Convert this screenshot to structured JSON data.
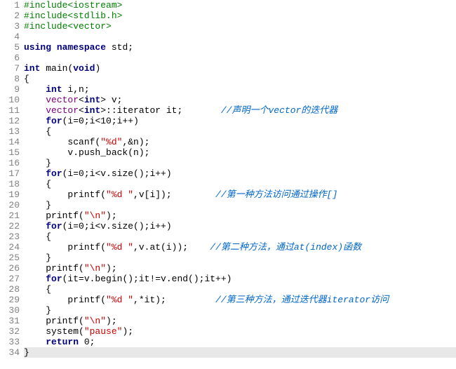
{
  "lines": [
    {
      "n": 1,
      "tokens": [
        {
          "cls": "preproc",
          "t": "#include<iostream>"
        }
      ]
    },
    {
      "n": 2,
      "tokens": [
        {
          "cls": "preproc",
          "t": "#include<stdlib.h>"
        }
      ]
    },
    {
      "n": 3,
      "tokens": [
        {
          "cls": "preproc",
          "t": "#include<vector>"
        }
      ]
    },
    {
      "n": 4,
      "tokens": []
    },
    {
      "n": 5,
      "tokens": [
        {
          "cls": "kw",
          "t": "using"
        },
        {
          "cls": "pn",
          "t": " "
        },
        {
          "cls": "kw",
          "t": "namespace"
        },
        {
          "cls": "pn",
          "t": " std;"
        }
      ]
    },
    {
      "n": 6,
      "tokens": []
    },
    {
      "n": 7,
      "tokens": [
        {
          "cls": "kw",
          "t": "int"
        },
        {
          "cls": "pn",
          "t": " "
        },
        {
          "cls": "id",
          "t": "main"
        },
        {
          "cls": "pn",
          "t": "("
        },
        {
          "cls": "kw",
          "t": "void"
        },
        {
          "cls": "pn",
          "t": ")"
        }
      ]
    },
    {
      "n": 8,
      "tokens": [
        {
          "cls": "pn",
          "t": "{"
        }
      ]
    },
    {
      "n": 9,
      "tokens": [
        {
          "cls": "pn",
          "t": "    "
        },
        {
          "cls": "kw",
          "t": "int"
        },
        {
          "cls": "pn",
          "t": " i,n;"
        }
      ]
    },
    {
      "n": 10,
      "tokens": [
        {
          "cls": "pn",
          "t": "    "
        },
        {
          "cls": "type",
          "t": "vector"
        },
        {
          "cls": "pn",
          "t": "<"
        },
        {
          "cls": "kw",
          "t": "int"
        },
        {
          "cls": "pn",
          "t": "> v;"
        }
      ]
    },
    {
      "n": 11,
      "tokens": [
        {
          "cls": "pn",
          "t": "    "
        },
        {
          "cls": "type",
          "t": "vector"
        },
        {
          "cls": "pn",
          "t": "<"
        },
        {
          "cls": "kw",
          "t": "int"
        },
        {
          "cls": "pn",
          "t": ">::iterator it;       "
        },
        {
          "cls": "cmt",
          "t": "//声明一个vector的迭代器"
        }
      ]
    },
    {
      "n": 12,
      "tokens": [
        {
          "cls": "pn",
          "t": "    "
        },
        {
          "cls": "kw",
          "t": "for"
        },
        {
          "cls": "pn",
          "t": "(i="
        },
        {
          "cls": "num",
          "t": "0"
        },
        {
          "cls": "pn",
          "t": ";i<"
        },
        {
          "cls": "num",
          "t": "10"
        },
        {
          "cls": "pn",
          "t": ";i++)"
        }
      ]
    },
    {
      "n": 13,
      "tokens": [
        {
          "cls": "pn",
          "t": "    {"
        }
      ]
    },
    {
      "n": 14,
      "tokens": [
        {
          "cls": "pn",
          "t": "        scanf("
        },
        {
          "cls": "str",
          "t": "\"%d\""
        },
        {
          "cls": "pn",
          "t": ",&n);"
        }
      ]
    },
    {
      "n": 15,
      "tokens": [
        {
          "cls": "pn",
          "t": "        v.push_back(n);"
        }
      ]
    },
    {
      "n": 16,
      "tokens": [
        {
          "cls": "pn",
          "t": "    }"
        }
      ]
    },
    {
      "n": 17,
      "tokens": [
        {
          "cls": "pn",
          "t": "    "
        },
        {
          "cls": "kw",
          "t": "for"
        },
        {
          "cls": "pn",
          "t": "(i="
        },
        {
          "cls": "num",
          "t": "0"
        },
        {
          "cls": "pn",
          "t": ";i<v.size();i++)"
        }
      ]
    },
    {
      "n": 18,
      "tokens": [
        {
          "cls": "pn",
          "t": "    {"
        }
      ]
    },
    {
      "n": 19,
      "tokens": [
        {
          "cls": "pn",
          "t": "        printf("
        },
        {
          "cls": "str",
          "t": "\"%d \""
        },
        {
          "cls": "pn",
          "t": ",v[i]);        "
        },
        {
          "cls": "cmt",
          "t": "//第一种方法访问通过操作[]"
        }
      ]
    },
    {
      "n": 20,
      "tokens": [
        {
          "cls": "pn",
          "t": "    }"
        }
      ]
    },
    {
      "n": 21,
      "tokens": [
        {
          "cls": "pn",
          "t": "    printf("
        },
        {
          "cls": "str",
          "t": "\"\\n\""
        },
        {
          "cls": "pn",
          "t": ");"
        }
      ]
    },
    {
      "n": 22,
      "tokens": [
        {
          "cls": "pn",
          "t": "    "
        },
        {
          "cls": "kw",
          "t": "for"
        },
        {
          "cls": "pn",
          "t": "(i="
        },
        {
          "cls": "num",
          "t": "0"
        },
        {
          "cls": "pn",
          "t": ";i<v.size();i++)"
        }
      ]
    },
    {
      "n": 23,
      "tokens": [
        {
          "cls": "pn",
          "t": "    {"
        }
      ]
    },
    {
      "n": 24,
      "tokens": [
        {
          "cls": "pn",
          "t": "        printf("
        },
        {
          "cls": "str",
          "t": "\"%d \""
        },
        {
          "cls": "pn",
          "t": ",v.at(i));    "
        },
        {
          "cls": "cmt",
          "t": "//第二种方法，通过at(index)函数"
        }
      ]
    },
    {
      "n": 25,
      "tokens": [
        {
          "cls": "pn",
          "t": "    }"
        }
      ]
    },
    {
      "n": 26,
      "tokens": [
        {
          "cls": "pn",
          "t": "    printf("
        },
        {
          "cls": "str",
          "t": "\"\\n\""
        },
        {
          "cls": "pn",
          "t": ");"
        }
      ]
    },
    {
      "n": 27,
      "tokens": [
        {
          "cls": "pn",
          "t": "    "
        },
        {
          "cls": "kw",
          "t": "for"
        },
        {
          "cls": "pn",
          "t": "(it=v.begin();it!=v.end();it++)"
        }
      ]
    },
    {
      "n": 28,
      "tokens": [
        {
          "cls": "pn",
          "t": "    {"
        }
      ]
    },
    {
      "n": 29,
      "tokens": [
        {
          "cls": "pn",
          "t": "        printf("
        },
        {
          "cls": "str",
          "t": "\"%d \""
        },
        {
          "cls": "pn",
          "t": ",*it);         "
        },
        {
          "cls": "cmt",
          "t": "//第三种方法，通过迭代器iterator访问"
        }
      ]
    },
    {
      "n": 30,
      "tokens": [
        {
          "cls": "pn",
          "t": "    }"
        }
      ]
    },
    {
      "n": 31,
      "tokens": [
        {
          "cls": "pn",
          "t": "    printf("
        },
        {
          "cls": "str",
          "t": "\"\\n\""
        },
        {
          "cls": "pn",
          "t": ");"
        }
      ]
    },
    {
      "n": 32,
      "tokens": [
        {
          "cls": "pn",
          "t": "    system("
        },
        {
          "cls": "str",
          "t": "\"pause\""
        },
        {
          "cls": "pn",
          "t": ");"
        }
      ]
    },
    {
      "n": 33,
      "tokens": [
        {
          "cls": "pn",
          "t": "    "
        },
        {
          "cls": "kw",
          "t": "return"
        },
        {
          "cls": "pn",
          "t": " "
        },
        {
          "cls": "num",
          "t": "0"
        },
        {
          "cls": "pn",
          "t": ";"
        }
      ]
    },
    {
      "n": 34,
      "tokens": [
        {
          "cls": "pn",
          "t": "}"
        }
      ],
      "hl": true
    }
  ]
}
